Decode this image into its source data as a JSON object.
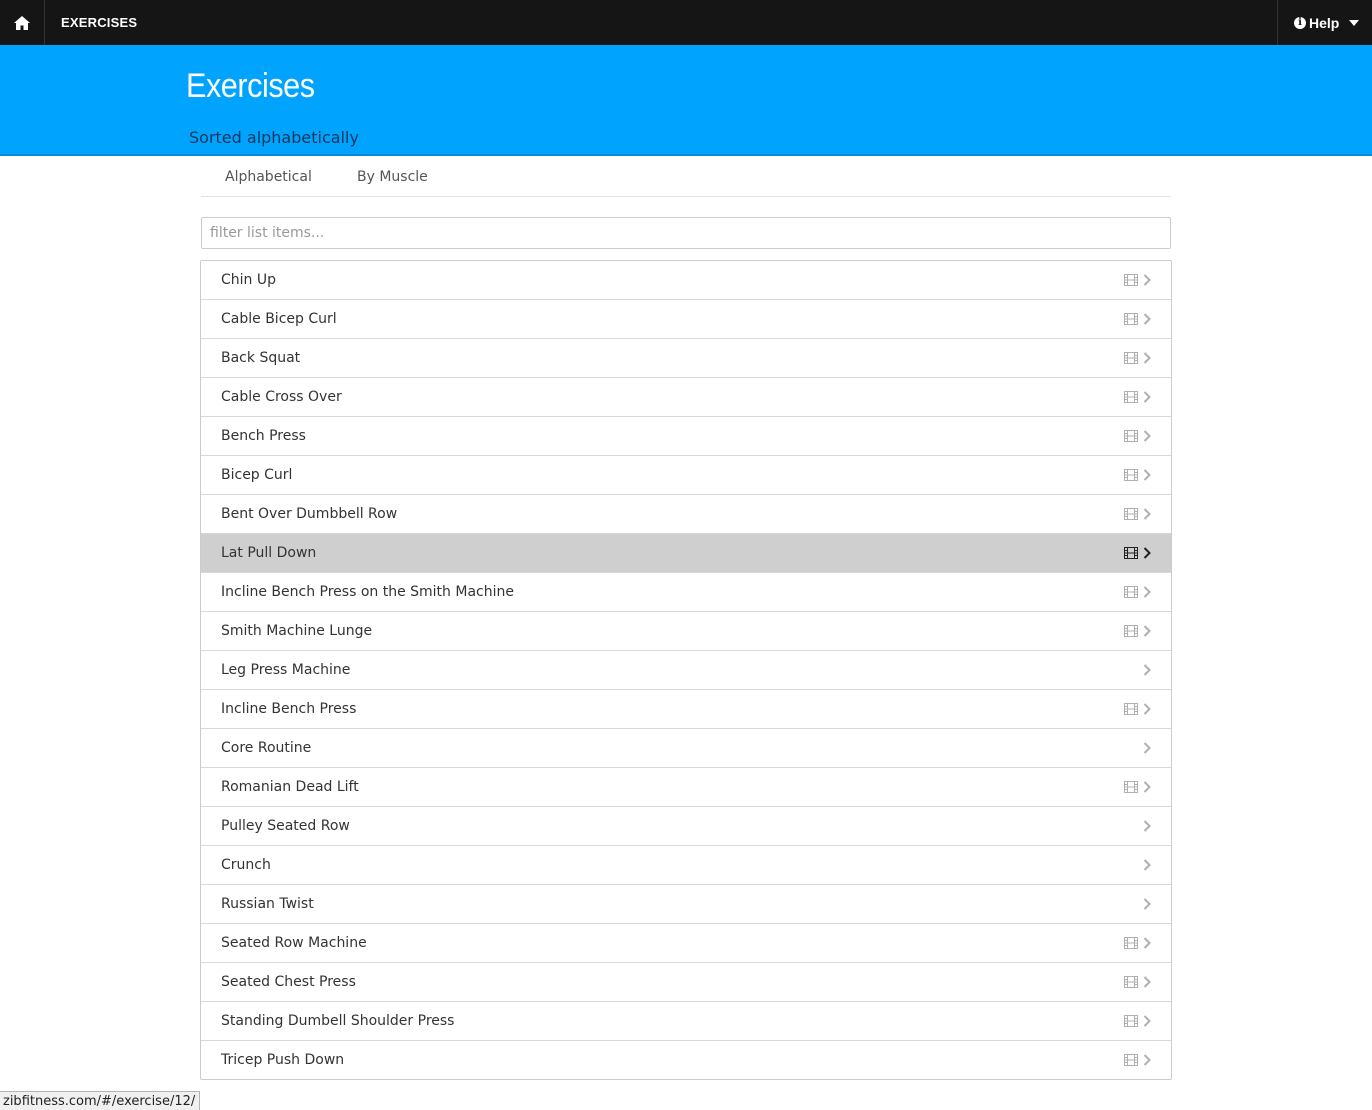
{
  "navbar": {
    "home_icon": "home-icon",
    "title": "EXERCISES",
    "help_label": "Help",
    "help_icon": "info-icon"
  },
  "header": {
    "title": "Exercises",
    "subtitle": "Sorted alphabetically",
    "background": "#00a4ff"
  },
  "tabs": [
    {
      "label": "Alphabetical"
    },
    {
      "label": "By Muscle"
    }
  ],
  "filter": {
    "placeholder": "filter list items...",
    "value": ""
  },
  "exercises": [
    {
      "name": "Chin Up",
      "has_video": true,
      "active": false
    },
    {
      "name": "Cable Bicep Curl",
      "has_video": true,
      "active": false
    },
    {
      "name": "Back Squat",
      "has_video": true,
      "active": false
    },
    {
      "name": "Cable Cross Over",
      "has_video": true,
      "active": false
    },
    {
      "name": "Bench Press",
      "has_video": true,
      "active": false
    },
    {
      "name": "Bicep Curl",
      "has_video": true,
      "active": false
    },
    {
      "name": "Bent Over Dumbbell Row",
      "has_video": true,
      "active": false
    },
    {
      "name": "Lat Pull Down",
      "has_video": true,
      "active": true
    },
    {
      "name": "Incline Bench Press on the Smith Machine",
      "has_video": true,
      "active": false
    },
    {
      "name": "Smith Machine Lunge",
      "has_video": true,
      "active": false
    },
    {
      "name": "Leg Press Machine",
      "has_video": false,
      "active": false
    },
    {
      "name": "Incline Bench Press",
      "has_video": true,
      "active": false
    },
    {
      "name": "Core Routine",
      "has_video": false,
      "active": false
    },
    {
      "name": "Romanian Dead Lift",
      "has_video": true,
      "active": false
    },
    {
      "name": "Pulley Seated Row",
      "has_video": false,
      "active": false
    },
    {
      "name": "Crunch",
      "has_video": false,
      "active": false
    },
    {
      "name": "Russian Twist",
      "has_video": false,
      "active": false
    },
    {
      "name": "Seated Row Machine",
      "has_video": true,
      "active": false
    },
    {
      "name": "Seated Chest Press",
      "has_video": true,
      "active": false
    },
    {
      "name": "Standing Dumbell Shoulder Press",
      "has_video": true,
      "active": false
    },
    {
      "name": "Tricep Push Down",
      "has_video": true,
      "active": false
    }
  ],
  "status_bar": {
    "url": "zibfitness.com/#/exercise/12/"
  }
}
